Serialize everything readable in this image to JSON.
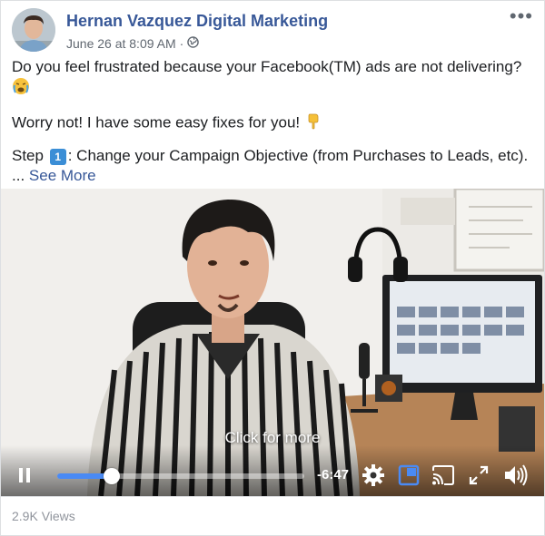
{
  "post": {
    "author": "Hernan Vazquez Digital Marketing",
    "timestamp": "June 26 at 8:09 AM",
    "separator": "·",
    "privacy_icon": "globe-icon",
    "more_label": "•••",
    "lines": [
      "Do you feel frustrated because your Facebook(TM) ads are not delivering?",
      "Worry not! I have some easy fixes for you!",
      "Step",
      ": Change your Campaign Objective (from Purchases to Leads, etc)."
    ],
    "keycap_number": "1",
    "ellipsis": "...",
    "see_more": "See More"
  },
  "video": {
    "overlay_text": "Click for more",
    "time_remaining": "-6:47",
    "progress_fraction": 0.22,
    "accent_color": "#4a8af4",
    "icons": [
      "pause-icon",
      "settings-icon",
      "fullscreen-box-icon",
      "cast-icon",
      "expand-icon",
      "volume-icon"
    ]
  },
  "footer": {
    "views": "2.9K Views"
  },
  "colors": {
    "link": "#385898",
    "meta": "#606770",
    "footer_text": "#90949c"
  }
}
